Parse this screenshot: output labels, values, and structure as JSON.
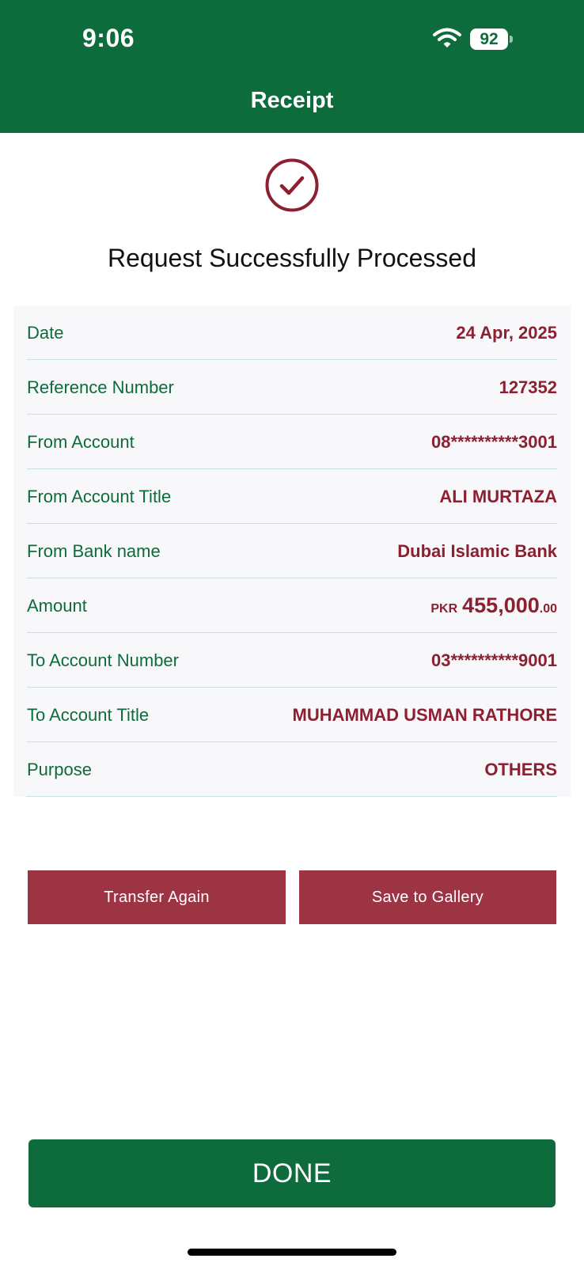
{
  "status_bar": {
    "time": "9:06",
    "battery": "92"
  },
  "header": {
    "title": "Receipt"
  },
  "success": {
    "message": "Request Successfully Processed"
  },
  "details": {
    "rows": [
      {
        "label": "Date",
        "value": "24 Apr, 2025"
      },
      {
        "label": "Reference Number",
        "value": "127352"
      },
      {
        "label": "From Account",
        "value": "08**********3001"
      },
      {
        "label": "From Account Title",
        "value": "ALI MURTAZA"
      },
      {
        "label": "From Bank name",
        "value": "Dubai Islamic Bank"
      },
      {
        "label": "Amount",
        "currency": "PKR",
        "value": "455,000",
        "decimals": ".00"
      },
      {
        "label": "To Account Number",
        "value": "03**********9001"
      },
      {
        "label": "To Account Title",
        "value": "MUHAMMAD USMAN RATHORE"
      },
      {
        "label": "Purpose",
        "value": "OTHERS"
      }
    ]
  },
  "actions": {
    "transfer_again": "Transfer Again",
    "save_to_gallery": "Save to Gallery"
  },
  "footer": {
    "done": "DONE"
  },
  "colors": {
    "brand_green": "#0e6b3b",
    "accent_red": "#8c1f30",
    "button_red": "#9d3444"
  },
  "icons": {
    "wifi": "wifi-icon",
    "success": "check-circle-icon"
  }
}
